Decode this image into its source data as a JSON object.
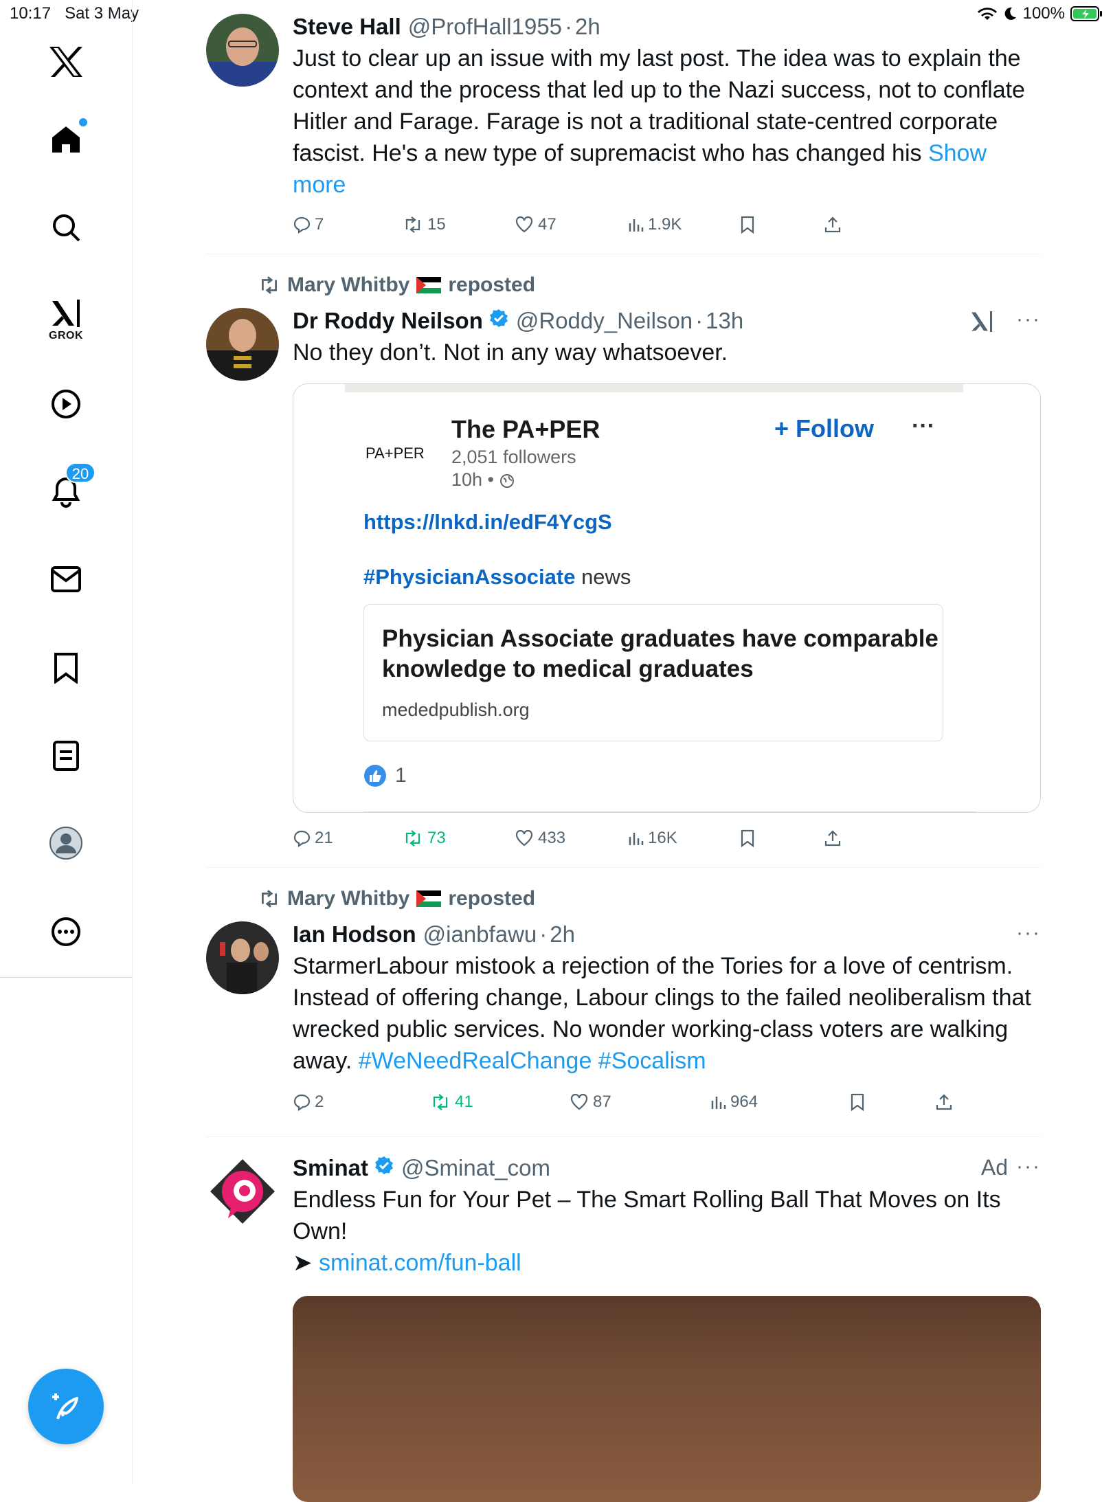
{
  "status_bar": {
    "time": "10:17",
    "date": "Sat 3 May",
    "battery": "100%"
  },
  "sidebar": {
    "grok_label": "GROK",
    "notifications_count": "20"
  },
  "posts": [
    {
      "name": "Steve Hall",
      "handle": "@ProfHall1955",
      "sep": "·",
      "time": "2h",
      "text": "Just to clear up an issue with my last post. The idea was to explain the context and the process that led up to the Nazi success, not to conflate Hitler and Farage. Farage is not a traditional state-centred corporate fascist. He's a new type of supremacist who has changed his ",
      "show_more": "Show more",
      "replies": "7",
      "reposts": "15",
      "likes": "47",
      "views": "1.9K"
    },
    {
      "reposted_by": "Mary Whitby",
      "reposted_label": "reposted",
      "name": "Dr Roddy Neilson",
      "handle": "@Roddy_Neilson",
      "sep": "·",
      "time": "13h",
      "text": "No they don’t. Not in any way whatsoever.",
      "card": {
        "logo_text": "PA+PER",
        "page_name": "The PA+PER",
        "followers": "2,051 followers",
        "time": "10h •",
        "follow_label": "+ Follow",
        "url": "https://lnkd.in/edF4YcgS",
        "hashtag": "#PhysicianAssociate",
        "hashtag_suffix": " news",
        "article_title": "Physician Associate graduates have comparable knowledge to medical graduates",
        "article_source": "mededpublish.org",
        "reactions": "1"
      },
      "replies": "21",
      "reposts": "73",
      "likes": "433",
      "views": "16K"
    },
    {
      "reposted_by": "Mary Whitby",
      "reposted_label": "reposted",
      "name": "Ian Hodson",
      "handle": "@ianbfawu",
      "sep": "·",
      "time": "2h",
      "text": "StarmerLabour mistook a rejection of the Tories for a love of centrism. Instead of offering change, Labour clings to the failed neoliberalism that wrecked public services. No wonder working-class voters are walking away. ",
      "hashtags": "#WeNeedRealChange #Socalism",
      "replies": "2",
      "reposts": "41",
      "likes": "87",
      "views": "964"
    },
    {
      "name": "Sminat",
      "handle": "@Sminat_com",
      "ad_label": "Ad",
      "text": "Endless Fun for Your Pet – The Smart Rolling Ball That Moves on Its Own!",
      "link_prefix": "➤ ",
      "link": "sminat.com/fun-ball"
    }
  ],
  "colors": {
    "accent": "#1d9bf0",
    "repost_green": "#00ba7c",
    "linkedin_blue": "#0a66c2"
  }
}
